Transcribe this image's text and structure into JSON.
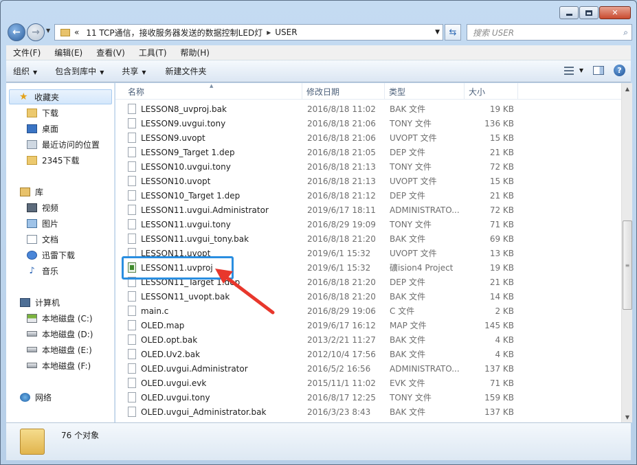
{
  "window": {
    "minimize": "—",
    "maximize": "□",
    "close": "✕"
  },
  "address": {
    "chevron": "«",
    "path": [
      "11 TCP通信，接收服务器发送的数据控制LED灯",
      "USER"
    ],
    "separator": "▸"
  },
  "search": {
    "placeholder": "搜索 USER"
  },
  "menu": [
    "文件(F)",
    "编辑(E)",
    "查看(V)",
    "工具(T)",
    "帮助(H)"
  ],
  "commands": [
    "组织",
    "包含到库中",
    "共享",
    "新建文件夹"
  ],
  "nav": {
    "favorites_title": "收藏夹",
    "favorites": [
      "下载",
      "桌面",
      "最近访问的位置",
      "2345下载"
    ],
    "libraries_title": "库",
    "libraries": [
      "视频",
      "图片",
      "文档",
      "迅雷下载",
      "音乐"
    ],
    "computer_title": "计算机",
    "drives": [
      "本地磁盘 (C:)",
      "本地磁盘 (D:)",
      "本地磁盘 (E:)",
      "本地磁盘 (F:)"
    ],
    "network_title": "网络"
  },
  "columns": {
    "name": "名称",
    "date": "修改日期",
    "type": "类型",
    "size": "大小"
  },
  "files": [
    {
      "name": "LESSON8_uvproj.bak",
      "date": "2016/8/18 11:02",
      "type": "BAK 文件",
      "size": "19 KB"
    },
    {
      "name": "LESSON9.uvgui.tony",
      "date": "2016/8/18 21:06",
      "type": "TONY 文件",
      "size": "136 KB"
    },
    {
      "name": "LESSON9.uvopt",
      "date": "2016/8/18 21:06",
      "type": "UVOPT 文件",
      "size": "15 KB"
    },
    {
      "name": "LESSON9_Target 1.dep",
      "date": "2016/8/18 21:05",
      "type": "DEP 文件",
      "size": "21 KB"
    },
    {
      "name": "LESSON10.uvgui.tony",
      "date": "2016/8/18 21:13",
      "type": "TONY 文件",
      "size": "72 KB"
    },
    {
      "name": "LESSON10.uvopt",
      "date": "2016/8/18 21:13",
      "type": "UVOPT 文件",
      "size": "15 KB"
    },
    {
      "name": "LESSON10_Target 1.dep",
      "date": "2016/8/18 21:12",
      "type": "DEP 文件",
      "size": "21 KB"
    },
    {
      "name": "LESSON11.uvgui.Administrator",
      "date": "2019/6/17 18:11",
      "type": "ADMINISTRATO...",
      "size": "72 KB"
    },
    {
      "name": "LESSON11.uvgui.tony",
      "date": "2016/8/29 19:09",
      "type": "TONY 文件",
      "size": "71 KB"
    },
    {
      "name": "LESSON11.uvgui_tony.bak",
      "date": "2016/8/18 21:20",
      "type": "BAK 文件",
      "size": "69 KB"
    },
    {
      "name": "LESSON11.uvopt",
      "date": "2019/6/1 15:32",
      "type": "UVOPT 文件",
      "size": "13 KB"
    },
    {
      "name": "LESSON11.uvproj",
      "date": "2019/6/1 15:32",
      "type": "礦ision4 Project",
      "size": "19 KB"
    },
    {
      "name": "LESSON11_Target 1.dep",
      "date": "2016/8/18 21:20",
      "type": "DEP 文件",
      "size": "21 KB"
    },
    {
      "name": "LESSON11_uvopt.bak",
      "date": "2016/8/18 21:20",
      "type": "BAK 文件",
      "size": "14 KB"
    },
    {
      "name": "main.c",
      "date": "2016/8/29 19:06",
      "type": "C 文件",
      "size": "2 KB"
    },
    {
      "name": "OLED.map",
      "date": "2019/6/17 16:12",
      "type": "MAP 文件",
      "size": "145 KB"
    },
    {
      "name": "OLED.opt.bak",
      "date": "2013/2/21 11:27",
      "type": "BAK 文件",
      "size": "4 KB"
    },
    {
      "name": "OLED.Uv2.bak",
      "date": "2012/10/4 17:56",
      "type": "BAK 文件",
      "size": "4 KB"
    },
    {
      "name": "OLED.uvgui.Administrator",
      "date": "2016/5/2 16:56",
      "type": "ADMINISTRATO...",
      "size": "137 KB"
    },
    {
      "name": "OLED.uvgui.evk",
      "date": "2015/11/1 11:02",
      "type": "EVK 文件",
      "size": "71 KB"
    },
    {
      "name": "OLED.uvgui.tony",
      "date": "2016/8/17 12:25",
      "type": "TONY 文件",
      "size": "159 KB"
    },
    {
      "name": "OLED.uvgui_Administrator.bak",
      "date": "2016/3/23 8:43",
      "type": "BAK 文件",
      "size": "137 KB"
    }
  ],
  "status": {
    "count": "76 个对象"
  },
  "colors": {
    "highlight": "#2a8ee0",
    "arrow": "#e8372c"
  }
}
